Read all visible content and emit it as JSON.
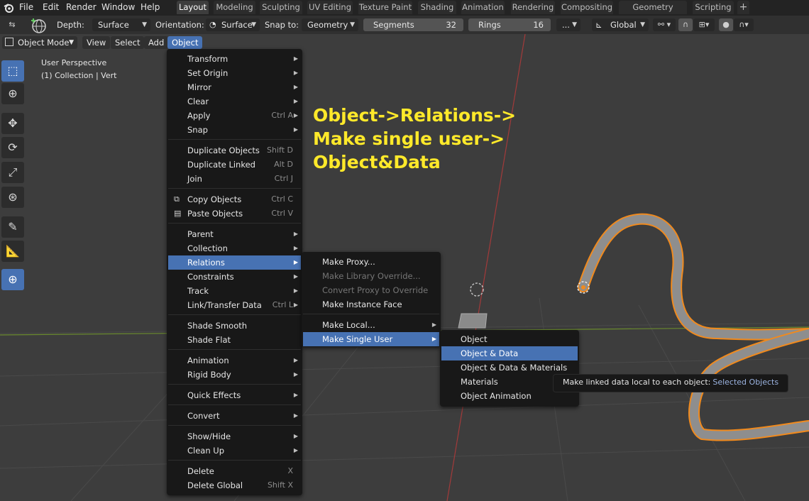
{
  "top_menu": {
    "items": [
      "File",
      "Edit",
      "Render",
      "Window",
      "Help"
    ],
    "workspaces": [
      "Layout",
      "Modeling",
      "Sculpting",
      "UV Editing",
      "Texture Paint",
      "Shading",
      "Animation",
      "Rendering",
      "Compositing",
      "Geometry Nodes",
      "Scripting"
    ],
    "active_workspace": "Layout",
    "add_workspace": "+"
  },
  "tool_header": {
    "depth_label": "Depth:",
    "depth_value": "Surface",
    "orientation_label": "Orientation:",
    "orientation_value": "Surface",
    "snap_label": "Snap to:",
    "snap_value": "Geometry",
    "segments_label": "Segments",
    "segments_value": "32",
    "rings_label": "Rings",
    "rings_value": "16",
    "more_label": "...",
    "transform_orientation": "Global"
  },
  "viewport_header": {
    "mode": "Object Mode",
    "menus": [
      "View",
      "Select",
      "Add",
      "Object"
    ],
    "active_menu": "Object"
  },
  "viewport": {
    "perspective": "User Perspective",
    "collection": "(1) Collection | Vert"
  },
  "annotation": {
    "line1": "Object->Relations->",
    "line2": "Make single user->",
    "line3": "Object&Data"
  },
  "object_menu": {
    "items": [
      {
        "label": "Transform",
        "shortcut": "",
        "submenu": true
      },
      {
        "label": "Set Origin",
        "shortcut": "",
        "submenu": true
      },
      {
        "label": "Mirror",
        "shortcut": "",
        "submenu": true
      },
      {
        "label": "Clear",
        "shortcut": "",
        "submenu": true
      },
      {
        "label": "Apply",
        "shortcut": "Ctrl A",
        "submenu": true
      },
      {
        "label": "Snap",
        "shortcut": "",
        "submenu": true
      },
      {
        "label": "Duplicate Objects",
        "shortcut": "Shift D",
        "submenu": false
      },
      {
        "label": "Duplicate Linked",
        "shortcut": "Alt D",
        "submenu": false
      },
      {
        "label": "Join",
        "shortcut": "Ctrl J",
        "submenu": false
      },
      {
        "label": "Copy Objects",
        "shortcut": "Ctrl C",
        "submenu": false
      },
      {
        "label": "Paste Objects",
        "shortcut": "Ctrl V",
        "submenu": false
      },
      {
        "label": "Parent",
        "shortcut": "",
        "submenu": true
      },
      {
        "label": "Collection",
        "shortcut": "",
        "submenu": true
      },
      {
        "label": "Relations",
        "shortcut": "",
        "submenu": true
      },
      {
        "label": "Constraints",
        "shortcut": "",
        "submenu": true
      },
      {
        "label": "Track",
        "shortcut": "",
        "submenu": true
      },
      {
        "label": "Link/Transfer Data",
        "shortcut": "Ctrl L",
        "submenu": true
      },
      {
        "label": "Shade Smooth",
        "shortcut": "",
        "submenu": false
      },
      {
        "label": "Shade Flat",
        "shortcut": "",
        "submenu": false
      },
      {
        "label": "Animation",
        "shortcut": "",
        "submenu": true
      },
      {
        "label": "Rigid Body",
        "shortcut": "",
        "submenu": true
      },
      {
        "label": "Quick Effects",
        "shortcut": "",
        "submenu": true
      },
      {
        "label": "Convert",
        "shortcut": "",
        "submenu": true
      },
      {
        "label": "Show/Hide",
        "shortcut": "",
        "submenu": true
      },
      {
        "label": "Clean Up",
        "shortcut": "",
        "submenu": true
      },
      {
        "label": "Delete",
        "shortcut": "X",
        "submenu": false
      },
      {
        "label": "Delete Global",
        "shortcut": "Shift X",
        "submenu": false
      }
    ]
  },
  "relations_menu": {
    "items": [
      {
        "label": "Make Proxy...",
        "disabled": false,
        "submenu": false
      },
      {
        "label": "Make Library Override...",
        "disabled": true,
        "submenu": false
      },
      {
        "label": "Convert Proxy to Override",
        "disabled": true,
        "submenu": false
      },
      {
        "label": "Make Instance Face",
        "disabled": false,
        "submenu": false
      },
      {
        "label": "Make Local...",
        "disabled": false,
        "submenu": true
      },
      {
        "label": "Make Single User",
        "disabled": false,
        "submenu": true
      }
    ]
  },
  "single_user_menu": {
    "items": [
      "Object",
      "Object & Data",
      "Object & Data & Materials",
      "Materials",
      "Object Animation"
    ]
  },
  "tooltip": {
    "text": "Make linked data local to each object:",
    "value": "Selected Objects"
  },
  "colors": {
    "accent": "#4772b3",
    "annotation": "#ffe92a",
    "selection_outline": "#f08a1e"
  }
}
